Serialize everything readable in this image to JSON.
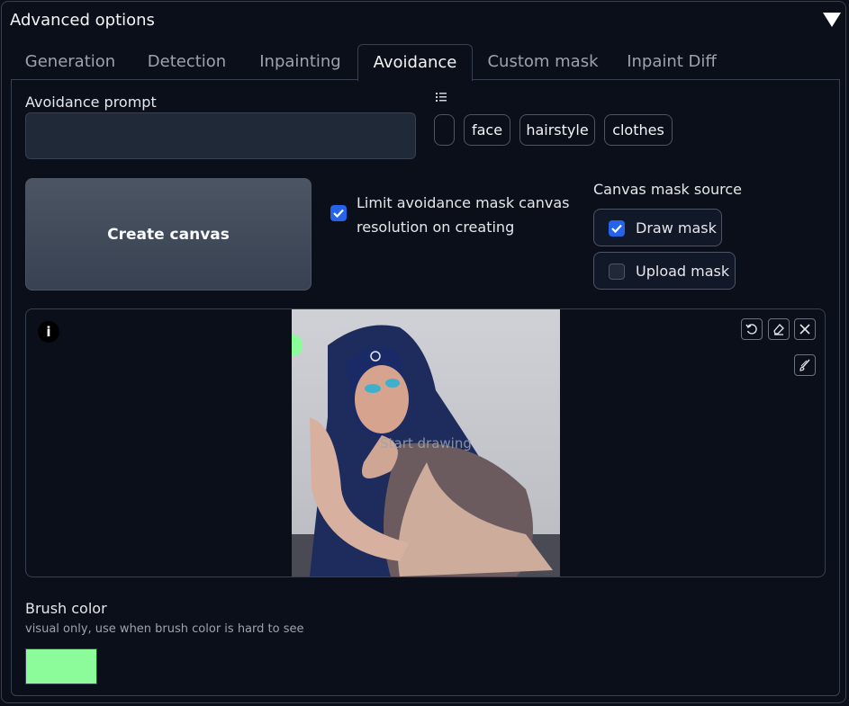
{
  "panel": {
    "title": "Advanced options"
  },
  "tabs": [
    {
      "label": "Generation"
    },
    {
      "label": "Detection"
    },
    {
      "label": "Inpainting"
    },
    {
      "label": "Avoidance"
    },
    {
      "label": "Custom mask"
    },
    {
      "label": "Inpaint Diff"
    }
  ],
  "active_tab": "Avoidance",
  "avoidance": {
    "prompt_label": "Avoidance prompt",
    "prompt_value": "",
    "chips": [
      "",
      "face",
      "hairstyle",
      "clothes"
    ],
    "create_button": "Create canvas",
    "limit_checkbox": {
      "label": "Limit avoidance mask canvas resolution on creating",
      "checked": true
    },
    "mask_source": {
      "label": "Canvas mask source",
      "options": [
        {
          "label": "Draw mask",
          "checked": true
        },
        {
          "label": "Upload mask",
          "checked": false
        }
      ]
    },
    "canvas": {
      "info_icon": "i",
      "placeholder": "Start drawing"
    },
    "brush": {
      "label": "Brush color",
      "hint": "visual only, use when brush color is hard to see",
      "color": "#8cfc9a"
    }
  },
  "colors": {
    "accent": "#2563eb",
    "background": "#0b0f19",
    "border": "#374151"
  }
}
